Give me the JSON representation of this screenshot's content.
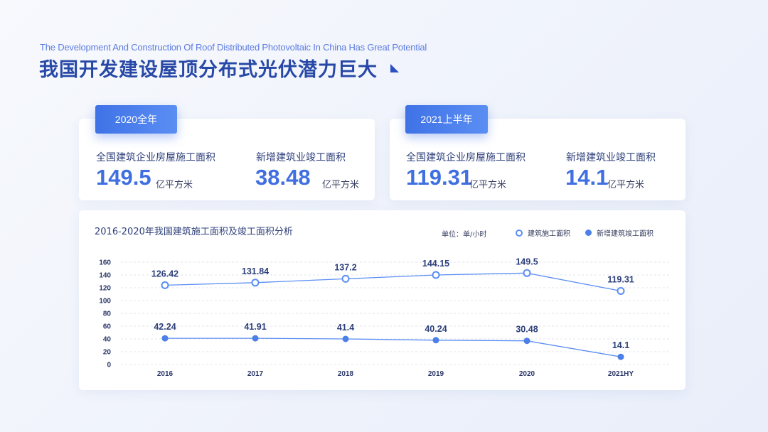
{
  "header": {
    "subtitle_en": "The Development And Construction Of Roof Distributed Photovoltaic In China Has Great Potential",
    "title": "我国开发建设屋顶分布式光伏潜力巨大"
  },
  "cards": [
    {
      "tag": "2020全年",
      "stats": [
        {
          "label": "全国建筑企业房屋施工面积",
          "value": "149.5",
          "unit": "亿平方米"
        },
        {
          "label": "新增建筑业竣工面积",
          "value": "38.48",
          "unit": "亿平方米"
        }
      ]
    },
    {
      "tag": "2021上半年",
      "stats": [
        {
          "label": "全国建筑企业房屋施工面积",
          "value": "119.31",
          "unit": "亿平方米"
        },
        {
          "label": "新增建筑业竣工面积",
          "value": "14.1",
          "unit": "亿平方米"
        }
      ]
    }
  ],
  "chart_data": {
    "type": "line",
    "title": "2016-2020年我国建筑施工面积及竣工面积分析",
    "unit_label": "单位：单/小时",
    "categories": [
      "2016",
      "2017",
      "2018",
      "2019",
      "2020",
      "2021HY"
    ],
    "ylim": [
      0,
      160
    ],
    "yticks": [
      0,
      20,
      40,
      60,
      80,
      100,
      120,
      140,
      160
    ],
    "grid": true,
    "legend_position": "top-right",
    "series": [
      {
        "name": "建筑施工面积",
        "marker": "hollow",
        "label_values": [
          "126.42",
          "131.84",
          "137.2",
          "144.15",
          "149.5",
          "119.31"
        ],
        "values": [
          124,
          128,
          134,
          140,
          143,
          115
        ]
      },
      {
        "name": "新增建筑竣工面积",
        "marker": "filled",
        "label_values": [
          "42.24",
          "41.91",
          "41.4",
          "40.24",
          "30.48",
          "14.1"
        ],
        "values": [
          41,
          41,
          40,
          38,
          37,
          12
        ]
      }
    ]
  },
  "colors": {
    "accent": "#3f6fe0",
    "line": "#5b8ef3",
    "title": "#2748a6",
    "grid": "#d8dde8"
  }
}
